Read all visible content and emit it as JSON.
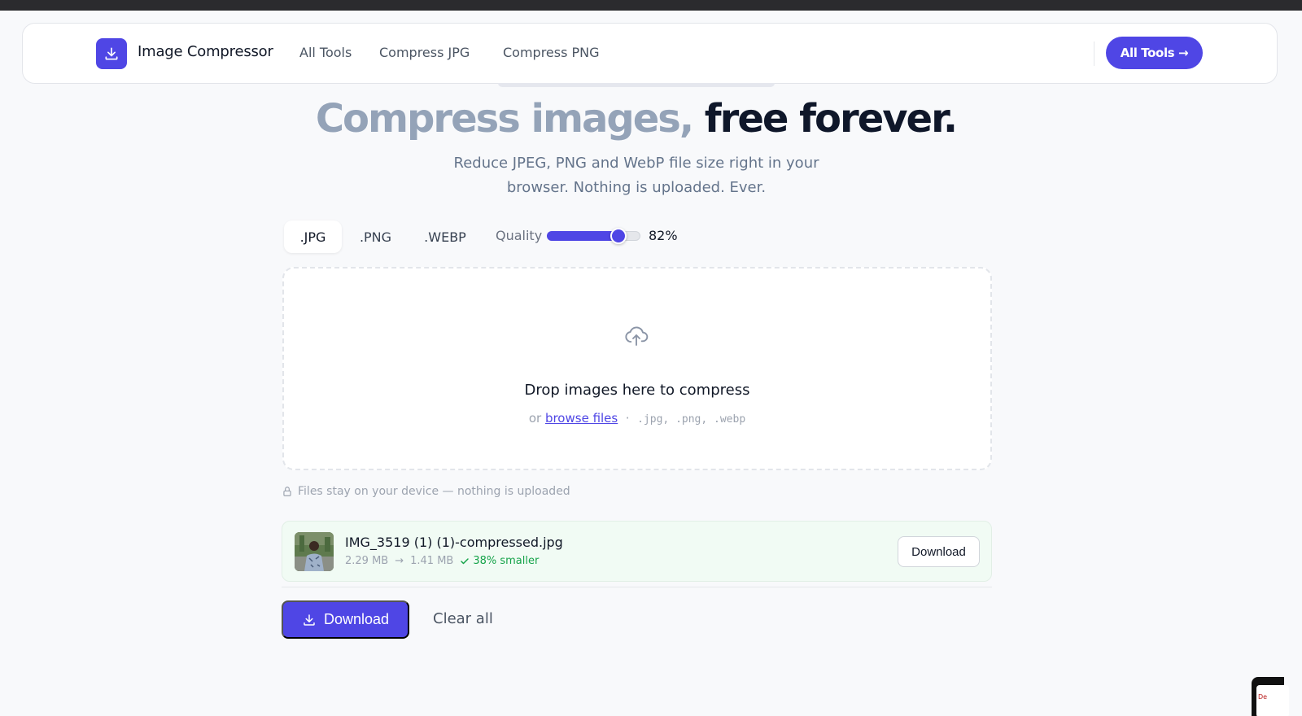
{
  "colors": {
    "accent": "#4f46e5",
    "success": "#16a34a",
    "heading_muted": "#94a3b8",
    "heading_strong": "#0f172a"
  },
  "nav": {
    "brand": "Image Compressor",
    "logo_icon": "download-icon",
    "links": [
      "All Tools",
      "Compress JPG",
      "Compress PNG"
    ],
    "cta_label": "All Tools →"
  },
  "hero": {
    "title_muted": "Compress images,",
    "title_strong": "free forever.",
    "subtitle": "Reduce JPEG, PNG and WebP file size right in your browser. Nothing is uploaded. Ever."
  },
  "controls": {
    "formats": [
      ".JPG",
      ".PNG",
      ".WEBP"
    ],
    "active_format": ".JPG",
    "quality_label": "Quality",
    "quality_value": "82%",
    "quality_fraction": 0.82
  },
  "dropzone": {
    "icon": "cloud-upload-icon",
    "title": "Drop images here to compress",
    "or_text": "or",
    "browse_label": "browse files",
    "separator": "·",
    "extensions": ".jpg, .png, .webp"
  },
  "privacy": {
    "icon": "lock-icon",
    "text": "Files stay on your device — nothing is uploaded"
  },
  "files": [
    {
      "name": "IMG_3519 (1) (1)-compressed.jpg",
      "original_size": "2.29 MB",
      "arrow": "→",
      "compressed_size": "1.41 MB",
      "saving": "38% smaller",
      "download_label": "Download"
    }
  ],
  "actions": {
    "download_all_label": "Download",
    "clear_label": "Clear all"
  },
  "corner_widget": {
    "text": "De"
  }
}
